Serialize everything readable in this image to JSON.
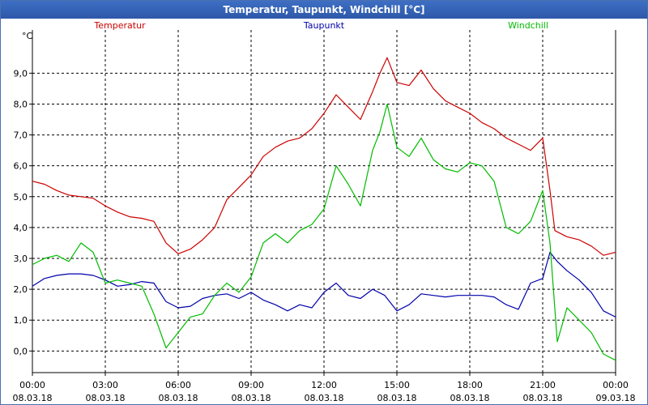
{
  "window": {
    "title": "Temperatur, Taupunkt, Windchill [°C]"
  },
  "chart_data": {
    "type": "line",
    "title": "Temperatur, Taupunkt, Windchill [°C]",
    "ylabel": "°C",
    "ylim": [
      -0.7,
      10.4
    ],
    "xlim": [
      0,
      24
    ],
    "grid": true,
    "y_ticks": [
      "0,0",
      "1,0",
      "2,0",
      "3,0",
      "4,0",
      "5,0",
      "6,0",
      "7,0",
      "8,0",
      "9,0"
    ],
    "x_ticks": [
      {
        "time": "00:00",
        "date": "08.03.18"
      },
      {
        "time": "03:00",
        "date": "08.03.18"
      },
      {
        "time": "06:00",
        "date": "08.03.18"
      },
      {
        "time": "09:00",
        "date": "08.03.18"
      },
      {
        "time": "12:00",
        "date": "08.03.18"
      },
      {
        "time": "15:00",
        "date": "08.03.18"
      },
      {
        "time": "18:00",
        "date": "08.03.18"
      },
      {
        "time": "21:00",
        "date": "08.03.18"
      },
      {
        "time": "00:00",
        "date": "09.03.18"
      }
    ],
    "series": [
      {
        "name": "Temperatur",
        "color": "#cc0000",
        "x": [
          0,
          0.5,
          1,
          1.5,
          2,
          2.5,
          3,
          3.5,
          4,
          4.5,
          5,
          5.5,
          6,
          6.5,
          7,
          7.5,
          8,
          8.5,
          9,
          9.5,
          10,
          10.5,
          11,
          11.5,
          12,
          12.5,
          13,
          13.5,
          14,
          14.3,
          14.6,
          15,
          15.5,
          16,
          16.5,
          17,
          17.5,
          18,
          18.5,
          19,
          19.5,
          20,
          20.5,
          21,
          21.3,
          21.5,
          22,
          22.5,
          23,
          23.5,
          24
        ],
        "values": [
          5.5,
          5.4,
          5.2,
          5.05,
          5.0,
          4.95,
          4.7,
          4.5,
          4.35,
          4.3,
          4.2,
          3.5,
          3.15,
          3.3,
          3.6,
          4.0,
          4.9,
          5.3,
          5.7,
          6.3,
          6.6,
          6.8,
          6.9,
          7.2,
          7.7,
          8.3,
          7.9,
          7.5,
          8.4,
          9.0,
          9.5,
          8.7,
          8.6,
          9.1,
          8.5,
          8.1,
          7.9,
          7.7,
          7.4,
          7.2,
          6.9,
          6.7,
          6.5,
          6.9,
          5.2,
          3.9,
          3.7,
          3.6,
          3.4,
          3.1,
          3.2
        ]
      },
      {
        "name": "Taupunkt",
        "color": "#0000aa",
        "x": [
          0,
          0.5,
          1,
          1.5,
          2,
          2.5,
          3,
          3.5,
          4,
          4.5,
          5,
          5.5,
          6,
          6.5,
          7,
          7.5,
          8,
          8.5,
          9,
          9.5,
          10,
          10.5,
          11,
          11.5,
          12,
          12.5,
          13,
          13.5,
          14,
          14.5,
          15,
          15.5,
          16,
          16.5,
          17,
          17.5,
          18,
          18.5,
          19,
          19.5,
          20,
          20.5,
          21,
          21.3,
          21.6,
          22,
          22.5,
          23,
          23.5,
          24
        ],
        "values": [
          2.1,
          2.35,
          2.45,
          2.5,
          2.5,
          2.45,
          2.3,
          2.1,
          2.15,
          2.25,
          2.2,
          1.6,
          1.4,
          1.45,
          1.7,
          1.8,
          1.85,
          1.7,
          1.9,
          1.65,
          1.5,
          1.3,
          1.5,
          1.4,
          1.9,
          2.2,
          1.8,
          1.7,
          2.0,
          1.8,
          1.3,
          1.5,
          1.85,
          1.8,
          1.75,
          1.8,
          1.8,
          1.8,
          1.75,
          1.5,
          1.35,
          2.2,
          2.35,
          3.2,
          2.9,
          2.6,
          2.3,
          1.9,
          1.3,
          1.1
        ]
      },
      {
        "name": "Windchill",
        "color": "#00bb00",
        "x": [
          0,
          0.5,
          1,
          1.5,
          2,
          2.5,
          3,
          3.5,
          4,
          4.5,
          5,
          5.5,
          6,
          6.5,
          7,
          7.5,
          8,
          8.5,
          9,
          9.5,
          10,
          10.5,
          11,
          11.5,
          12,
          12.5,
          13,
          13.5,
          14,
          14.3,
          14.6,
          15,
          15.5,
          16,
          16.5,
          17,
          17.5,
          18,
          18.5,
          19,
          19.5,
          20,
          20.5,
          21,
          21.3,
          21.6,
          22,
          22.5,
          23,
          23.5,
          24
        ],
        "values": [
          2.8,
          3.0,
          3.1,
          2.9,
          3.5,
          3.2,
          2.2,
          2.3,
          2.2,
          2.1,
          1.2,
          0.1,
          0.6,
          1.1,
          1.2,
          1.8,
          2.2,
          1.9,
          2.4,
          3.5,
          3.8,
          3.5,
          3.9,
          4.1,
          4.6,
          6.0,
          5.4,
          4.7,
          6.5,
          7.1,
          8.0,
          6.6,
          6.3,
          6.9,
          6.2,
          5.9,
          5.8,
          6.1,
          6.0,
          5.5,
          4.0,
          3.8,
          4.2,
          5.2,
          3.5,
          0.3,
          1.4,
          1.0,
          0.6,
          -0.1,
          -0.3
        ]
      }
    ]
  }
}
